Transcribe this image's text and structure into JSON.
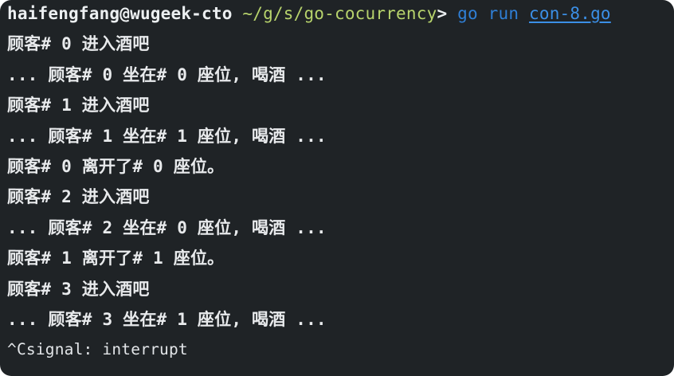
{
  "prompt": {
    "user_host": "haifengfang@wugeek-cto",
    "path": "~/g/s/go-cocurrency",
    "symbol": ">",
    "command": "go",
    "subcommand": "run",
    "file": "con-8.go"
  },
  "output_lines": [
    "顾客# 0 进入酒吧",
    "... 顾客# 0 坐在# 0 座位, 喝酒 ...",
    "顾客# 1 进入酒吧",
    "... 顾客# 1 坐在# 1 座位, 喝酒 ...",
    "顾客# 0 离开了# 0 座位。",
    "顾客# 2 进入酒吧",
    "... 顾客# 2 坐在# 0 座位, 喝酒 ...",
    "顾客# 1 离开了# 1 座位。",
    "顾客# 3 进入酒吧",
    "... 顾客# 3 坐在# 1 座位, 喝酒 ..."
  ],
  "last_line": "^Csignal: interrupt",
  "colors": {
    "background": "#1f2326",
    "text": "#e8eaec",
    "path": "#b7d36c",
    "command": "#2f7fd6"
  }
}
